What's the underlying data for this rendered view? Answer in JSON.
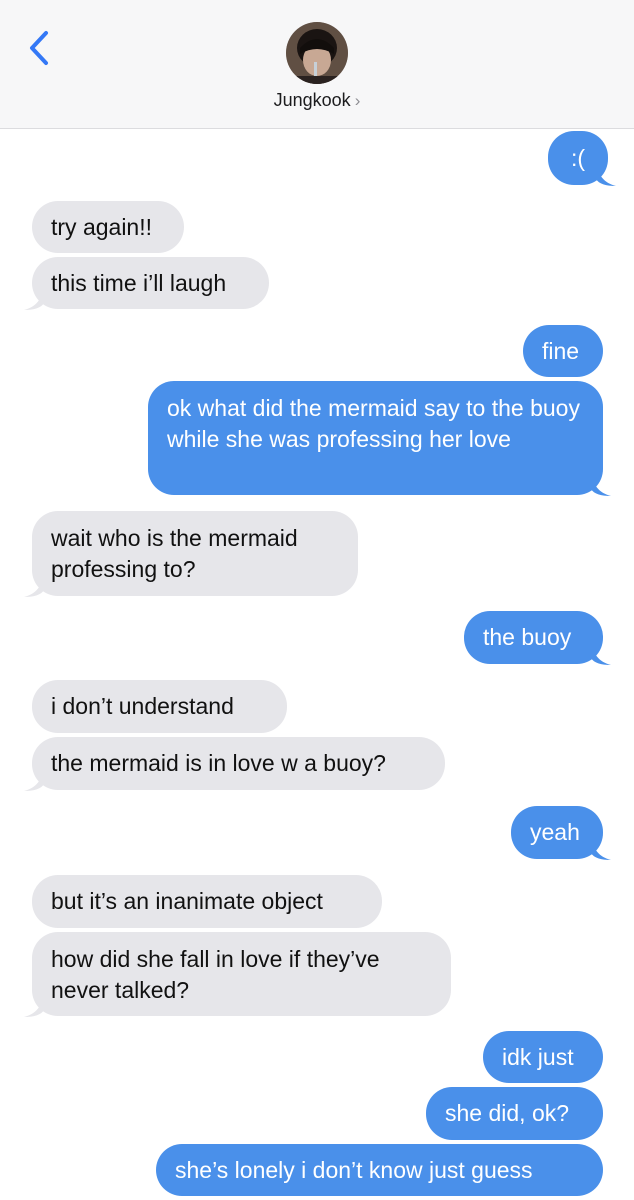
{
  "header": {
    "contact_name": "Jungkook",
    "chevron": "›",
    "back_icon": "chevron-left-icon",
    "accent_color": "#3478f6"
  },
  "colors": {
    "sent_bubble": "#4a90ea",
    "received_bubble": "#e6e6ea"
  },
  "messages": [
    {
      "from": "me",
      "text": ":("
    },
    {
      "from": "them",
      "text": "try again!!"
    },
    {
      "from": "them",
      "text": "this time i’ll laugh"
    },
    {
      "from": "me",
      "text": "fine"
    },
    {
      "from": "me",
      "text": "ok what did the mermaid say to the buoy while she was professing her love"
    },
    {
      "from": "them",
      "text": "wait who is the mermaid professing to?"
    },
    {
      "from": "me",
      "text": "the buoy"
    },
    {
      "from": "them",
      "text": "i don’t understand"
    },
    {
      "from": "them",
      "text": "the mermaid is in love w a buoy?"
    },
    {
      "from": "me",
      "text": "yeah"
    },
    {
      "from": "them",
      "text": "but it’s an inanimate object"
    },
    {
      "from": "them",
      "text": "how did she fall in love if they’ve never talked?"
    },
    {
      "from": "me",
      "text": "idk just"
    },
    {
      "from": "me",
      "text": "she did, ok?"
    },
    {
      "from": "me",
      "text": "she’s lonely i don’t know just guess"
    }
  ]
}
